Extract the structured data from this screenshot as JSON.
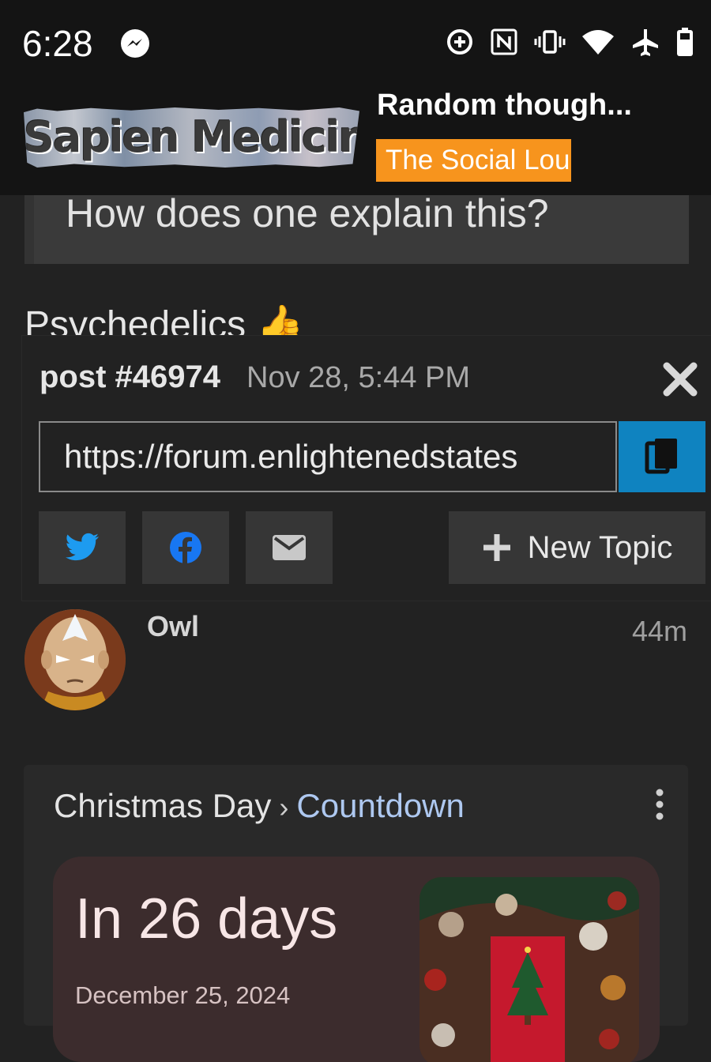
{
  "status_bar": {
    "time": "6:28"
  },
  "header": {
    "logo_text": "Sapien Medicine",
    "topic_title": "Random though...",
    "category": "The Social Lou"
  },
  "post": {
    "quote": "How does one explain this?",
    "reply_text": "Psychedelics",
    "reply_emoji": "👍"
  },
  "share": {
    "post_number": "post #46974",
    "date": "Nov 28, 5:44 PM",
    "url": "https://forum.enlightenedstates",
    "new_topic_label": "New Topic"
  },
  "next_post": {
    "username": "Owl",
    "age": "44m"
  },
  "card": {
    "breadcrumb_1": "Christmas Day",
    "separator": "›",
    "breadcrumb_2": "Countdown",
    "countdown": "In 26 days",
    "date": "December 25, 2024"
  },
  "colors": {
    "background": "#222222",
    "category_badge": "#f7941d",
    "copy_button": "#0f83c0",
    "twitter": "#1d9bf0",
    "facebook": "#1877f2"
  },
  "icons": [
    "messenger-icon",
    "data-saver-icon",
    "nfc-icon",
    "vibrate-icon",
    "wifi-icon",
    "airplane-icon",
    "battery-icon",
    "close-icon",
    "copy-icon",
    "twitter-icon",
    "facebook-icon",
    "email-icon",
    "plus-icon",
    "more-vert-icon"
  ]
}
